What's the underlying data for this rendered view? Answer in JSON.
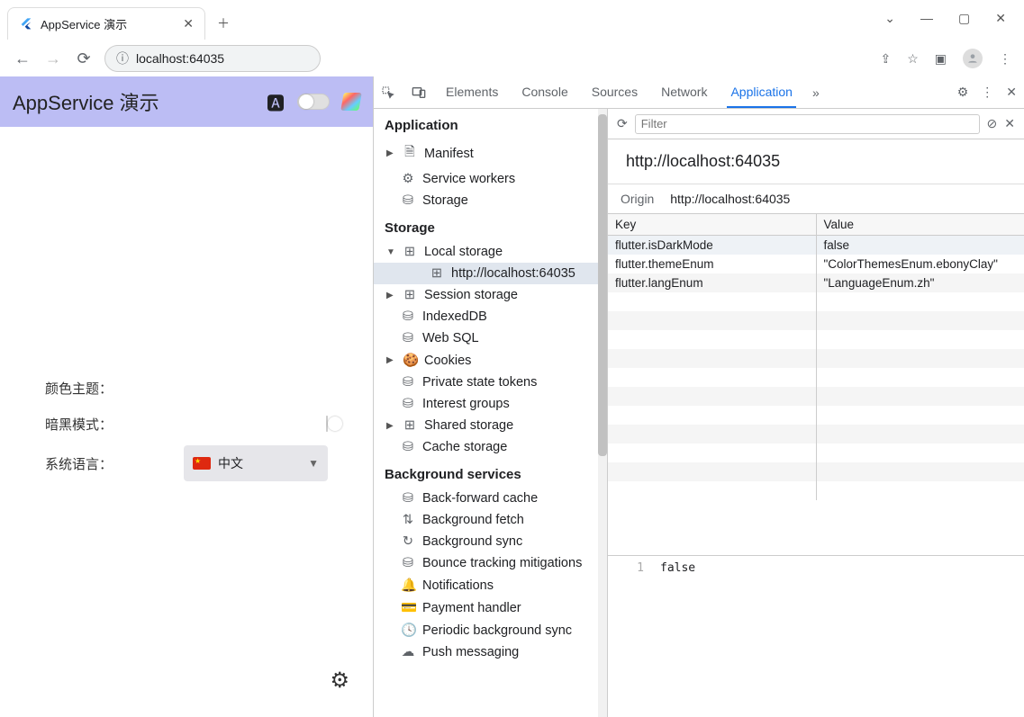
{
  "browser": {
    "tab_title": "AppService 演示",
    "address": "localhost:64035"
  },
  "app": {
    "title": "AppService 演示",
    "rows": {
      "color_theme": "颜色主题：",
      "dark_mode": "暗黑模式：",
      "lang": "系统语言："
    },
    "lang_value": "中文"
  },
  "devtools": {
    "tabs": {
      "elements": "Elements",
      "console": "Console",
      "sources": "Sources",
      "network": "Network",
      "application": "Application"
    },
    "filter_placeholder": "Filter",
    "sidebar": {
      "application_header": "Application",
      "application": {
        "manifest": "Manifest",
        "sw": "Service workers",
        "storage": "Storage"
      },
      "storage_header": "Storage",
      "storage": {
        "local": "Local storage",
        "local_item": "http://localhost:64035",
        "session": "Session storage",
        "idb": "IndexedDB",
        "websql": "Web SQL",
        "cookies": "Cookies",
        "pst": "Private state tokens",
        "ig": "Interest groups",
        "shared": "Shared storage",
        "cache": "Cache storage"
      },
      "bg_header": "Background services",
      "bg": {
        "bf": "Back-forward cache",
        "fetch": "Background fetch",
        "sync": "Background sync",
        "bounce": "Bounce tracking mitigations",
        "notif": "Notifications",
        "pay": "Payment handler",
        "periodic": "Periodic background sync",
        "push": "Push messaging"
      }
    },
    "origin": {
      "url": "http://localhost:64035",
      "label": "Origin",
      "value": "http://localhost:64035"
    },
    "table": {
      "headers": {
        "key": "Key",
        "value": "Value"
      },
      "rows": [
        {
          "key": "flutter.isDarkMode",
          "value": "false"
        },
        {
          "key": "flutter.themeEnum",
          "value": "\"ColorThemesEnum.ebonyClay\""
        },
        {
          "key": "flutter.langEnum",
          "value": "\"LanguageEnum.zh\""
        }
      ]
    },
    "preview": {
      "line": "1",
      "value": "false"
    }
  }
}
